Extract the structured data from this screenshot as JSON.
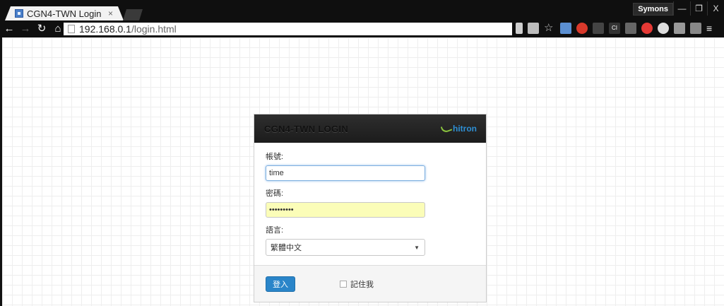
{
  "browser": {
    "tab_title": "CGN4-TWN Login",
    "tab_close": "×",
    "profile_name": "Symons",
    "url_host": "192.168.0.1",
    "url_path": "/login.html",
    "window_controls": [
      "—",
      "❐",
      "X"
    ]
  },
  "login": {
    "title": "CGN4-TWN LOGIN",
    "brand": "hitron",
    "username_label": "帳號:",
    "username_value": "time",
    "password_label": "密碼:",
    "password_value": "•••••••••",
    "language_label": "語言:",
    "language_selected": "繁體中文",
    "login_button": "登入",
    "remember_label": "記住我"
  },
  "colors": {
    "accent": "#2a85c9",
    "autofill": "#fbfdb8",
    "header_dark": "#1c1c1c",
    "brand_green": "#8cc63f"
  }
}
